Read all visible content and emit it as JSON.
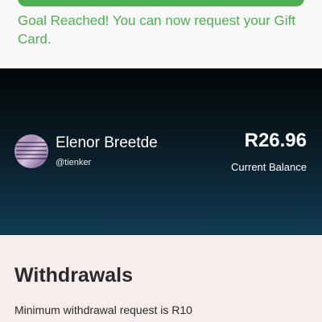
{
  "goal": {
    "message": "Goal Reached! You can now request your Gift Card.",
    "progress": 1.0,
    "accent_color": "#4caf50"
  },
  "profile": {
    "name": "Elenor Breetde",
    "handle": "@tienker",
    "avatar_icon": "profile-avatar-image"
  },
  "balance": {
    "amount": "R26.96",
    "label": "Current Balance"
  },
  "withdrawals": {
    "title": "Withdrawals",
    "minimum_text": "Minimum withdrawal request is R10"
  }
}
